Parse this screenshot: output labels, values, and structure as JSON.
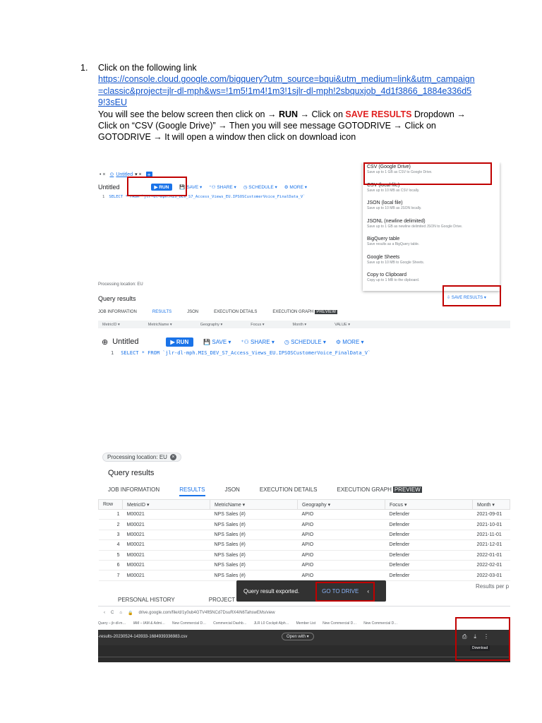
{
  "instructions": {
    "number": "1.",
    "intro": "Click on the following link",
    "link": "https://console.cloud.google.com/bigquery?utm_source=bqui&utm_medium=link&utm_campaign=classic&project=jlr-dl-mph&ws=!1m5!1m4!1m3!1sjlr-dl-mph!2sbquxjob_4d1f3866_1884e336d59!3sEU",
    "p1": "You will see the below screen then click on → ",
    "run": "RUN",
    "p2": " → Click on ",
    "save_results": "SAVE RESULTS",
    "p3": " Dropdown → Click on “CSV (Google Drive)” → Then you will see message GOTODRIVE → Click on GOTODRIVE → It will open a window then click on download icon"
  },
  "shot1": {
    "tab_close": "• ×",
    "tab_label": "Untitled",
    "tab_caret": "▾ ×",
    "tab_plus": "+",
    "title": "Untitled",
    "run": "RUN",
    "save": "SAVE ▾",
    "share": "SHARE ▾",
    "schedule": "SCHEDULE ▾",
    "more": "MORE ▾",
    "sql_line": "1",
    "sql": "SELECT * FROM `jlr-dl-mph.MIS_DEV_S7_Access_Views_EU.IPSOSCustomerVoice_FinalData_V`",
    "processing": "Processing location: EU",
    "query_results": "Query results",
    "result_tabs": [
      "JOB INFORMATION",
      "RESULTS",
      "JSON",
      "EXECUTION DETAILS",
      "EXECUTION GRAPH"
    ],
    "preview": "PREVIEW",
    "columns": [
      "MetricID ▾",
      "MetricName ▾",
      "Geography ▾",
      "Focus ▾",
      "Month ▾",
      "VALUE ▾"
    ],
    "save_results_btn": "SAVE RESULTS ▾",
    "menu": [
      {
        "title": "CSV (Google Drive)",
        "sub": "Save up to 1 GB as CSV to Google Drive."
      },
      {
        "title": "CSV (local file)",
        "sub": "Save up to 10 MB as CSV locally."
      },
      {
        "title": "JSON (local file)",
        "sub": "Save up to 10 MB as JSON locally."
      },
      {
        "title": "JSONL (newline delimited)",
        "sub": "Save up to 1 GB as newline delimited JSON to Google Drive."
      },
      {
        "title": "BigQuery table",
        "sub": "Save results as a BigQuery table."
      },
      {
        "title": "Google Sheets",
        "sub": "Save up to 10 MB to Google Sheets."
      },
      {
        "title": "Copy to Clipboard",
        "sub": "Copy up to 1 MB to the clipboard."
      }
    ]
  },
  "shot2": {
    "title": "Untitled",
    "run": "RUN",
    "save": "SAVE ▾",
    "share": "SHARE ▾",
    "schedule": "SCHEDULE ▾",
    "more": "MORE ▾",
    "sql_line": "1",
    "sql": "SELECT * FROM `jlr-dl-mph.MIS_DEV_S7_Access_Views_EU.IPSOSCustomerVoice_FinalData_V`",
    "processing": "Processing location: EU",
    "query_results": "Query results",
    "result_tabs": [
      "JOB INFORMATION",
      "RESULTS",
      "JSON",
      "EXECUTION DETAILS",
      "EXECUTION GRAPH"
    ],
    "preview": "PREVIEW",
    "headers": [
      "Row",
      "MetricID ▾",
      "MetricName ▾",
      "Geography ▾",
      "Focus ▾",
      "Month ▾"
    ],
    "rows": [
      [
        "1",
        "M00021",
        "NPS Sales (#)",
        "APIO",
        "Defender",
        "2021-09-01"
      ],
      [
        "2",
        "M00021",
        "NPS Sales (#)",
        "APIO",
        "Defender",
        "2021-10-01"
      ],
      [
        "3",
        "M00021",
        "NPS Sales (#)",
        "APIO",
        "Defender",
        "2021-11-01"
      ],
      [
        "4",
        "M00021",
        "NPS Sales (#)",
        "APIO",
        "Defender",
        "2021-12-01"
      ],
      [
        "5",
        "M00021",
        "NPS Sales (#)",
        "APIO",
        "Defender",
        "2022-01-01"
      ],
      [
        "6",
        "M00021",
        "NPS Sales (#)",
        "APIO",
        "Defender",
        "2022-02-01"
      ],
      [
        "7",
        "M00021",
        "NPS Sales (#)",
        "APIO",
        "Defender",
        "2022-03-01"
      ]
    ],
    "results_per_page": "Results per p",
    "toast_msg": "Query result exported.",
    "go_to_drive": "GO TO DRIVE",
    "personal_history": "PERSONAL HISTORY",
    "project_history": "PROJECT HISTORY",
    "url": "drive.google.com/file/d/1y0ub4GTV4ft5NCd7DsuRX4iN6TahswEMs/view",
    "bookmarks": [
      "Query – jlr-dl-m…",
      "IAM – IAM & Admi…",
      "New Commercial D…",
      "Commercial Dashb…",
      "JLR L0 Cockpit Alph…",
      "Member List",
      "New Commercial D…",
      "New Commercial D…"
    ],
    "file_name": "-results-20230524-143933-1684939336983.csv",
    "open_with": "Open with ▾",
    "download_tip": "Download"
  },
  "colors": {
    "accent": "#1a73e8",
    "highlight": "#c00000",
    "save_results": "#e02020"
  }
}
